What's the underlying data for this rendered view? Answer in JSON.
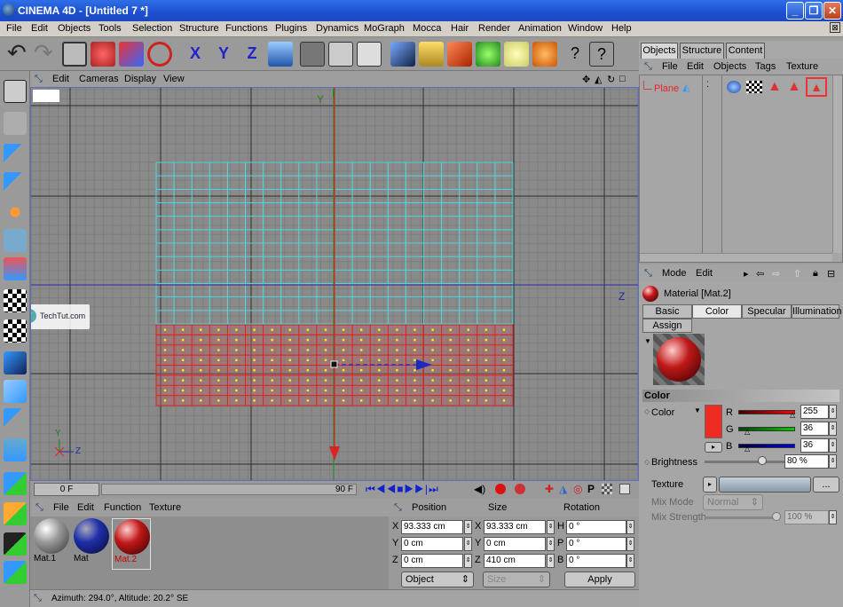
{
  "window": {
    "title": "CINEMA 4D - [Untitled 7 *]"
  },
  "menu": [
    "File",
    "Edit",
    "Objects",
    "Tools",
    "Selection",
    "Structure",
    "Functions",
    "Plugins",
    "Dynamics",
    "MoGraph",
    "Mocca",
    "Hair",
    "Render",
    "Animation",
    "Window",
    "Help"
  ],
  "viewport": {
    "menu": [
      "Edit",
      "Cameras",
      "Display",
      "View"
    ],
    "axis_y": "Y",
    "axis_z": "Z",
    "watermark": "TechTut.com",
    "gizmo_y": "Y",
    "gizmo_z": "Z"
  },
  "timeline": {
    "start": "0 F",
    "end": "90 F"
  },
  "materials": {
    "menu": [
      "File",
      "Edit",
      "Function",
      "Texture"
    ],
    "items": [
      {
        "label": "Mat.1",
        "color": "#9a9a9a"
      },
      {
        "label": "Mat",
        "color": "#1e2fa8"
      },
      {
        "label": "Mat.2",
        "color": "#c01818"
      }
    ]
  },
  "coords": {
    "headers": [
      "Position",
      "Size",
      "Rotation"
    ],
    "rows": [
      {
        "pl": "X",
        "pos": "93.333 cm",
        "sl": "X",
        "size": "93.333 cm",
        "rl": "H",
        "rot": "0 °"
      },
      {
        "pl": "Y",
        "pos": "0 cm",
        "sl": "Y",
        "size": "0 cm",
        "rl": "P",
        "rot": "0 °"
      },
      {
        "pl": "Z",
        "pos": "0 cm",
        "sl": "Z",
        "size": "410 cm",
        "rl": "B",
        "rot": "0 °"
      }
    ],
    "mode": "Object",
    "size_mode": "Size",
    "apply": "Apply"
  },
  "status": "Azimuth: 294.0°, Altitude: 20.2° SE",
  "right": {
    "tabs": [
      "Objects",
      "Structure",
      "Content"
    ],
    "obj_menu": [
      "File",
      "Edit",
      "Objects",
      "Tags",
      "Texture"
    ],
    "object_name": "Plane",
    "attr_menu": [
      "Mode",
      "Edit"
    ],
    "material_title": "Material [Mat.2]",
    "attr_tabs": [
      "Basic",
      "Color",
      "Specular",
      "Illumination"
    ],
    "assign": "Assign",
    "section": "Color",
    "color_label": "Color",
    "r_label": "R",
    "r": "255",
    "g_label": "G",
    "g": "36",
    "b_label": "B",
    "b": "36",
    "brightness_label": "Brightness",
    "brightness": "80 %",
    "texture_label": "Texture",
    "texture_more": "...",
    "mixmode_label": "Mix Mode",
    "mixmode": "Normal",
    "mixstrength_label": "Mix Strength",
    "mixstrength": "100 %",
    "swatch_color": "#ef2a22"
  }
}
